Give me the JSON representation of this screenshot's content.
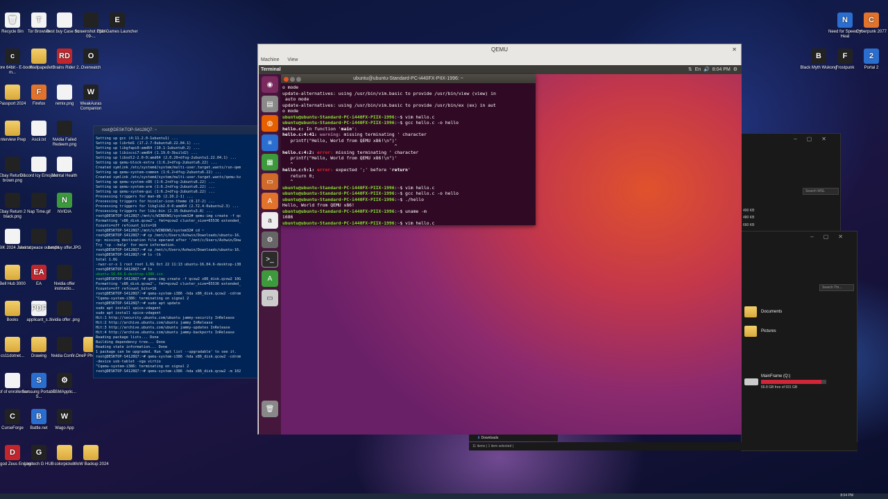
{
  "desktop": {
    "icons_left": [
      {
        "label": "Recycle Bin",
        "glyph": "🗑",
        "cls": "f-doc"
      },
      {
        "label": "Tor Browser",
        "glyph": "T",
        "cls": "f-doc"
      },
      {
        "label": "Best buy Case nu...",
        "glyph": "",
        "cls": "f-doc"
      },
      {
        "label": "Screenshot 2024-09-...",
        "glyph": "",
        "cls": "f-dark"
      },
      {
        "label": "Epic Games Launcher",
        "glyph": "E",
        "cls": "f-dark"
      },
      {
        "label": "calibre 64bit - E-book m...",
        "glyph": "c",
        "cls": "f-dark"
      },
      {
        "label": "Wallpaper",
        "glyph": "",
        "cls": "f-folder"
      },
      {
        "label": "JetBrains Rider 2...",
        "glyph": "RD",
        "cls": "f-red"
      },
      {
        "label": "Overwatch",
        "glyph": "O",
        "cls": "f-dark"
      },
      {
        "label": "Passport 2024",
        "glyph": "",
        "cls": "f-folder"
      },
      {
        "label": "Firefox",
        "glyph": "F",
        "cls": "f-orange"
      },
      {
        "label": "remix.png",
        "glyph": "",
        "cls": "f-doc"
      },
      {
        "label": "WeakAuras Companion",
        "glyph": "W",
        "cls": "f-dark"
      },
      {
        "label": "Interview Prep",
        "glyph": "",
        "cls": "f-folder"
      },
      {
        "label": "Ascii.txt",
        "glyph": "",
        "cls": "f-doc"
      },
      {
        "label": "Nvidia Failed Redeem.png",
        "glyph": "",
        "cls": "f-dark"
      },
      {
        "label": "Ebay Return 1 brown.png",
        "glyph": "",
        "cls": "f-dark"
      },
      {
        "label": "Discord Icy Emoji.txt",
        "glyph": "",
        "cls": "f-doc"
      },
      {
        "label": "Mental Health",
        "glyph": "",
        "cls": "f-doc"
      },
      {
        "label": "Ebay Return 2 black.png",
        "glyph": "",
        "cls": "f-dark"
      },
      {
        "label": "Nap Time.gif",
        "glyph": "",
        "cls": "f-dark"
      },
      {
        "label": "NVIDIA",
        "glyph": "N",
        "cls": "f-green"
      },
      {
        "label": "LASIK 2024 June.txt",
        "glyph": "",
        "cls": "f-doc"
      },
      {
        "label": "Verina peace out.mp4",
        "glyph": "",
        "cls": "f-dark"
      },
      {
        "label": "bestbuy offer.JPG",
        "glyph": "",
        "cls": "f-dark"
      },
      {
        "label": "Bell Hub 3000",
        "glyph": "",
        "cls": "f-folder"
      },
      {
        "label": "EA",
        "glyph": "EA",
        "cls": "f-red"
      },
      {
        "label": "Nvidia offer instructio...",
        "glyph": "",
        "cls": "f-dark"
      },
      {
        "label": "Books",
        "glyph": "",
        "cls": "f-folder"
      },
      {
        "label": "applicant_s...",
        "glyph": "PDF",
        "cls": "f-doc"
      },
      {
        "label": "Nvidia offer .png",
        "glyph": "",
        "cls": "f-dark"
      },
      {
        "label": "cs11dotnet...",
        "glyph": "",
        "cls": "f-folder"
      },
      {
        "label": "Drawing",
        "glyph": "",
        "cls": "f-folder"
      },
      {
        "label": "Nvidia Confir...",
        "glyph": "",
        "cls": "f-dark"
      },
      {
        "label": "OneP Photo D...",
        "glyph": "",
        "cls": "f-folder"
      },
      {
        "label": "Proof of enrollemen...",
        "glyph": "",
        "cls": "f-doc"
      },
      {
        "label": "Samsung Portable S...",
        "glyph": "S",
        "cls": "f-blue"
      },
      {
        "label": "TSMApplic...",
        "glyph": "⚙",
        "cls": "f-dark"
      },
      {
        "label": "CurseForge",
        "glyph": "C",
        "cls": "f-dark"
      },
      {
        "label": "Battle.net",
        "glyph": "B",
        "cls": "f-blue"
      },
      {
        "label": "Wago App",
        "glyph": "W",
        "cls": "f-dark"
      },
      {
        "label": "Durgod Zeus Engine",
        "glyph": "D",
        "cls": "f-red"
      },
      {
        "label": "Logitech G HUB",
        "glyph": "G",
        "cls": "f-dark"
      },
      {
        "label": "colorpicker",
        "glyph": "",
        "cls": "f-folder"
      },
      {
        "label": "WoW Backup 2024",
        "glyph": "",
        "cls": "f-folder"
      }
    ],
    "icons_right": [
      {
        "label": "Need for Speed™ Heat",
        "glyph": "N",
        "cls": "f-blue"
      },
      {
        "label": "Cyberpunk 2077",
        "glyph": "C",
        "cls": "f-orange"
      },
      {
        "label": "Black Myth Wukong",
        "glyph": "B",
        "cls": "f-dark"
      },
      {
        "label": "Frostpunk",
        "glyph": "F",
        "cls": "f-dark"
      },
      {
        "label": "Portal 2",
        "glyph": "2",
        "cls": "f-blue"
      }
    ]
  },
  "cmd": {
    "title": "root@DESKTOP-S4128Q7: ~",
    "lines": [
      "Setting up gcc (4:11.2.0-1ubuntu1) ...",
      "Setting up librbd1 (17.2.7-0ubuntu0.22.04.1) ...",
      "Setting up libgfapi0:amd64 (10.1-1ubuntu0.2) ...",
      "Setting up libiscsi7:amd64 (1.19.0-3build2) ...",
      "Setting up libsdl2-2.0-0:amd64 (2.0.20+dfsg-2ubuntu1.22.04.1) ...",
      "Setting up qemu-block-extra (1:6.2+dfsg-2ubuntu6.22) ...",
      "Created symlink /etc/systemd/system/multi-user.target.wants/run-qem",
      "Setting up qemu-system-common (1:6.2+dfsg-2ubuntu6.22) ...",
      "Created symlink /etc/systemd/system/multi-user.target.wants/qemu-kv",
      "Setting up qemu-system-x86 (1:6.2+dfsg-2ubuntu6.22) ...",
      "Setting up qemu-system-arm (1:6.2+dfsg-2ubuntu6.22) ...",
      "Setting up qemu-system-gui (1:6.2+dfsg-2ubuntu6.22) ...",
      "Processing triggers for man-db (2.10.2-1) ...",
      "Processing triggers for hicolor-icon-theme (0.17-2) ...",
      "Processing triggers for libglib2.0-0:amd64 (2.72.4-0ubuntu2.3) ...",
      "Processing triggers for libc-bin (2.35-0ubuntu3.8) ...",
      "root@DESKTOP-S4128Q7:/mnt/c/WINDOWS/system32# qemu-img create -f qc",
      "Formatting 'x86_disk.qcow2', fmt=qcow2 cluster_size=65536 extended_",
      "fcounts=off refcount_bits=16",
      "root@DESKTOP-S4128Q7:/mnt/c/WINDOWS/system32# cd ~",
      "root@DESKTOP-S4128Q7:~# cp /mnt/c/Users/Ashwin/Downloads/ubuntu-16.",
      "cp: missing destination file operand after '/mnt/c/Users/Ashwin/Dow",
      "Try 'cp --help' for more information.",
      "root@DESKTOP-S4128Q7:~# cp /mnt/c/Users/Ashwin/Downloads/ubuntu-16.",
      "root@DESKTOP-S4128Q7:~# ls -lh",
      "total 1.6G",
      "-rwxr-xr-x 1 root root 1.6G Oct 22 11:13 ubuntu-16.04.6-desktop-i38",
      "root@DESKTOP-S4128Q7:~# ls",
      "ubuntu-16.04.6-desktop-i386.iso",
      "root@DESKTOP-S4128Q7:~# qemu-img create -f qcow2 x86_disk.qcow2 10G",
      "Formatting 'x86_disk.qcow2', fmt=qcow2 cluster_size=65536 extended_",
      "fcounts=off refcount_bits=16",
      "root@DESKTOP-S4128Q7:~# qemu-system-i386 -hda x86_disk.qcow2 -cdrom",
      "^Cqemu-system-i386: terminating on signal 2",
      "root@DESKTOP-S4128Q7:~# sudo apt update",
      "sudo apt install spice-vdagent",
      "sudo apt install spice-vdagent",
      "Hit:1 http://security.ubuntu.com/ubuntu jammy-security InRelease",
      "Hit:2 http://archive.ubuntu.com/ubuntu jammy InRelease",
      "Hit:3 http://archive.ubuntu.com/ubuntu jammy-updates InRelease",
      "Hit:4 http://archive.ubuntu.com/ubuntu jammy-backports InRelease",
      "Reading package lists... Done",
      "Building dependency tree... Done",
      "Reading state information... Done",
      "1 package can be upgraded. Run 'apt list --upgradable' to see it.",
      "root@DESKTOP-S4128Q7:~# qemu-system-i386 -hda x86_disk.qcow2 -cdrom",
      "-device usb-tablet -vga virtio",
      "^Cqemu-system-i386: terminating on signal 2",
      "root@DESKTOP-S4128Q7:~# qemu-system-i386 -hda x86_disk.qcow2 -m 102"
    ]
  },
  "explorer1": {
    "search": "Search WSL",
    "sizes": [
      "400 KB",
      "480 KB",
      "660 KB"
    ]
  },
  "explorer2": {
    "search": "Search Thi...",
    "folders": [
      "Documents",
      "Pictures"
    ],
    "drive_label": "MainFrame (Q:)",
    "drive_free": "66.8 GB free of 931 GB",
    "drive_fill_pct": 93,
    "status": "11 items  |  1 item selected  |",
    "nav": "Downloads"
  },
  "qemu": {
    "title": "QEMU",
    "menu": [
      "Machine",
      "View"
    ],
    "topbar_app": "Terminal",
    "topbar_time": "8:04 PM",
    "terminal_title": "ubuntu@ubuntu-Standard-PC-i440FX-PIIX-1996: ~",
    "prompt": "ubuntu@ubuntu-Standard-PC-i440FX-PIIX-1996",
    "lines": [
      {
        "t": "o mode"
      },
      {
        "t": "update-alternatives: using /usr/bin/vim.basic to provide /usr/bin/view (view) in"
      },
      {
        "t": " auto mode"
      },
      {
        "t": "update-alternatives: using /usr/bin/vim.basic to provide /usr/bin/ex (ex) in aut"
      },
      {
        "t": "o mode"
      },
      {
        "p": true,
        "cmd": "vim hello.c"
      },
      {
        "p": true,
        "cmd": "gcc hello.c -o hello"
      },
      {
        "b": "hello.c:",
        "t": " In function '",
        "b2": "main",
        "t2": "':"
      },
      {
        "b": "hello.c:4:41: ",
        "w": "warning:",
        "t": " missing terminating ' character"
      },
      {
        "t": "   printf(\"Hello, World from QEMU x86!\\n\")'"
      },
      {
        "t": "                                          ^"
      },
      {
        "b": "hello.c:4:2: ",
        "e": "error:",
        "t": " missing terminating ' character"
      },
      {
        "t": "   printf(\"Hello, World from QEMU x86!\\n\")'"
      },
      {
        "t": "   ^"
      },
      {
        "b": "hello.c:5:1: ",
        "e": "error:",
        "t": " expected ';' before '",
        "b2": "return",
        "t2": "'"
      },
      {
        "t": "   return 0;"
      },
      {
        "t": "   ^"
      },
      {
        "p": true,
        "cmd": "vim hello.c"
      },
      {
        "p": true,
        "cmd": "gcc hello.c -o hello"
      },
      {
        "p": true,
        "cmd": "./hello"
      },
      {
        "t": "Hello, World from QEMU x86!"
      },
      {
        "p": true,
        "cmd": "uname -m"
      },
      {
        "t": "i686"
      },
      {
        "p": true,
        "cmd": "vim hello.c"
      }
    ]
  },
  "taskbar": {
    "time": "8:04 PM"
  }
}
